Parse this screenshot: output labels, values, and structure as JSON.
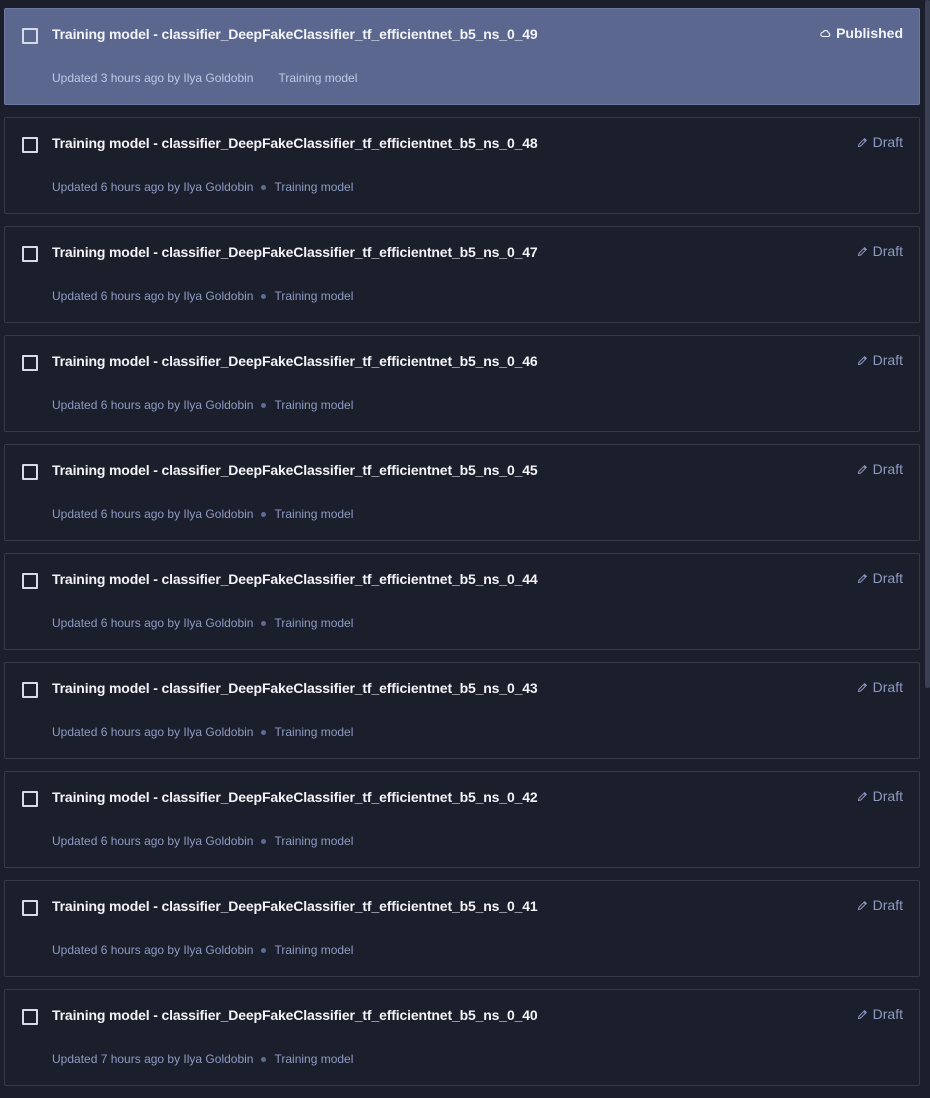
{
  "items": [
    {
      "title": "Training model - classifier_DeepFakeClassifier_tf_efficientnet_b5_ns_0_49",
      "updated": "Updated 3 hours ago by Ilya Goldobin",
      "type": "Training model",
      "status": "Published",
      "status_icon": "cloud-icon",
      "selected": true
    },
    {
      "title": "Training model - classifier_DeepFakeClassifier_tf_efficientnet_b5_ns_0_48",
      "updated": "Updated 6 hours ago by Ilya Goldobin",
      "type": "Training model",
      "status": "Draft",
      "status_icon": "pencil-icon",
      "selected": false
    },
    {
      "title": "Training model - classifier_DeepFakeClassifier_tf_efficientnet_b5_ns_0_47",
      "updated": "Updated 6 hours ago by Ilya Goldobin",
      "type": "Training model",
      "status": "Draft",
      "status_icon": "pencil-icon",
      "selected": false
    },
    {
      "title": "Training model - classifier_DeepFakeClassifier_tf_efficientnet_b5_ns_0_46",
      "updated": "Updated 6 hours ago by Ilya Goldobin",
      "type": "Training model",
      "status": "Draft",
      "status_icon": "pencil-icon",
      "selected": false
    },
    {
      "title": "Training model - classifier_DeepFakeClassifier_tf_efficientnet_b5_ns_0_45",
      "updated": "Updated 6 hours ago by Ilya Goldobin",
      "type": "Training model",
      "status": "Draft",
      "status_icon": "pencil-icon",
      "selected": false
    },
    {
      "title": "Training model - classifier_DeepFakeClassifier_tf_efficientnet_b5_ns_0_44",
      "updated": "Updated 6 hours ago by Ilya Goldobin",
      "type": "Training model",
      "status": "Draft",
      "status_icon": "pencil-icon",
      "selected": false
    },
    {
      "title": "Training model - classifier_DeepFakeClassifier_tf_efficientnet_b5_ns_0_43",
      "updated": "Updated 6 hours ago by Ilya Goldobin",
      "type": "Training model",
      "status": "Draft",
      "status_icon": "pencil-icon",
      "selected": false
    },
    {
      "title": "Training model - classifier_DeepFakeClassifier_tf_efficientnet_b5_ns_0_42",
      "updated": "Updated 6 hours ago by Ilya Goldobin",
      "type": "Training model",
      "status": "Draft",
      "status_icon": "pencil-icon",
      "selected": false
    },
    {
      "title": "Training model - classifier_DeepFakeClassifier_tf_efficientnet_b5_ns_0_41",
      "updated": "Updated 6 hours ago by Ilya Goldobin",
      "type": "Training model",
      "status": "Draft",
      "status_icon": "pencil-icon",
      "selected": false
    },
    {
      "title": "Training model - classifier_DeepFakeClassifier_tf_efficientnet_b5_ns_0_40",
      "updated": "Updated 7 hours ago by Ilya Goldobin",
      "type": "Training model",
      "status": "Draft",
      "status_icon": "pencil-icon",
      "selected": false
    }
  ],
  "colors": {
    "background": "#1b1e2b",
    "selected_background": "#5c6790",
    "card_border": "#353a4b",
    "muted_text": "#8e9bc3",
    "title_text": "#f3f4f8"
  }
}
